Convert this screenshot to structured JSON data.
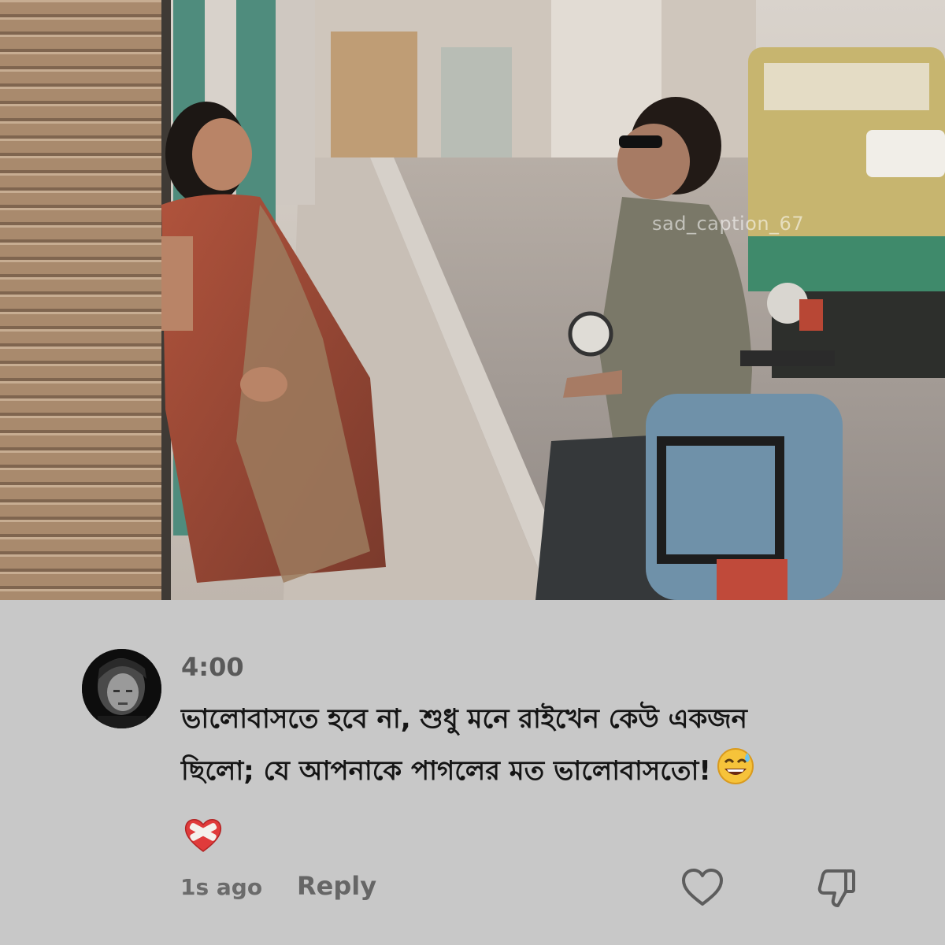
{
  "photo": {
    "watermark": "sad_caption_67"
  },
  "comment": {
    "time": "4:00",
    "text_line1": "ভালোবাসতে হবে না, শুধু মনে রাইখেন কেউ একজন",
    "text_line2": "ছিলো; যে আপনাকে পাগলের মত ভালোবাসতো!",
    "emoji_inline": "sweat-smile-emoji",
    "emoji_heart": "mending-heart-emoji",
    "ago": "1s ago",
    "reply_label": "Reply"
  },
  "colors": {
    "card_background": "#c8c8c8",
    "text_primary": "#151515",
    "text_secondary": "#666666"
  }
}
